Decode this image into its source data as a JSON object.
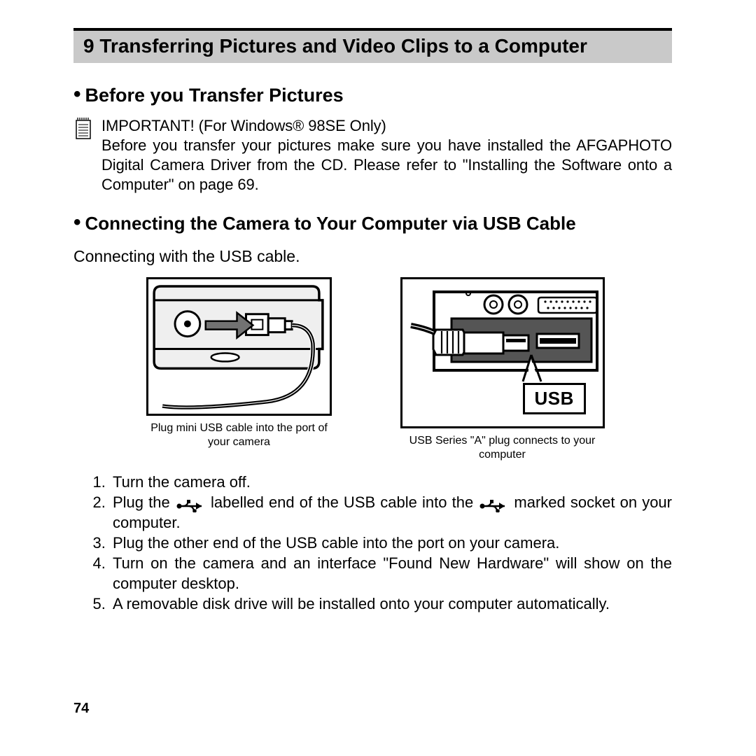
{
  "chapter": {
    "number": "9",
    "title": "Transferring Pictures and Video Clips to a Computer"
  },
  "section1": {
    "title": "Before you Transfer Pictures"
  },
  "note": {
    "heading": "IMPORTANT! (For Windows® 98SE Only)",
    "body": "Before you transfer your pictures make sure you have installed the AFGAPHOTO Digital Camera Driver from the CD. Please refer to \"Installing the Software onto a Computer\" on page 69."
  },
  "section2": {
    "title": "Connecting the Camera to Your Computer via USB Cable",
    "caption": "Connecting with the USB cable."
  },
  "figures": {
    "camera_caption": "Plug mini USB cable into the port of your camera",
    "computer_caption": "USB Series \"A\" plug connects to your computer",
    "usb_label": "USB"
  },
  "steps": {
    "s1": "Turn the camera off.",
    "s2a": "Plug the ",
    "s2b": " labelled end of the USB cable into the ",
    "s2c": " marked socket on your computer.",
    "s3": "Plug the other end of the USB cable into the port on your camera.",
    "s4": "Turn on the camera and an interface \"Found New Hardware\" will show on the computer desktop.",
    "s5": "A removable disk drive will be installed onto your computer automatically."
  },
  "page_number": "74"
}
